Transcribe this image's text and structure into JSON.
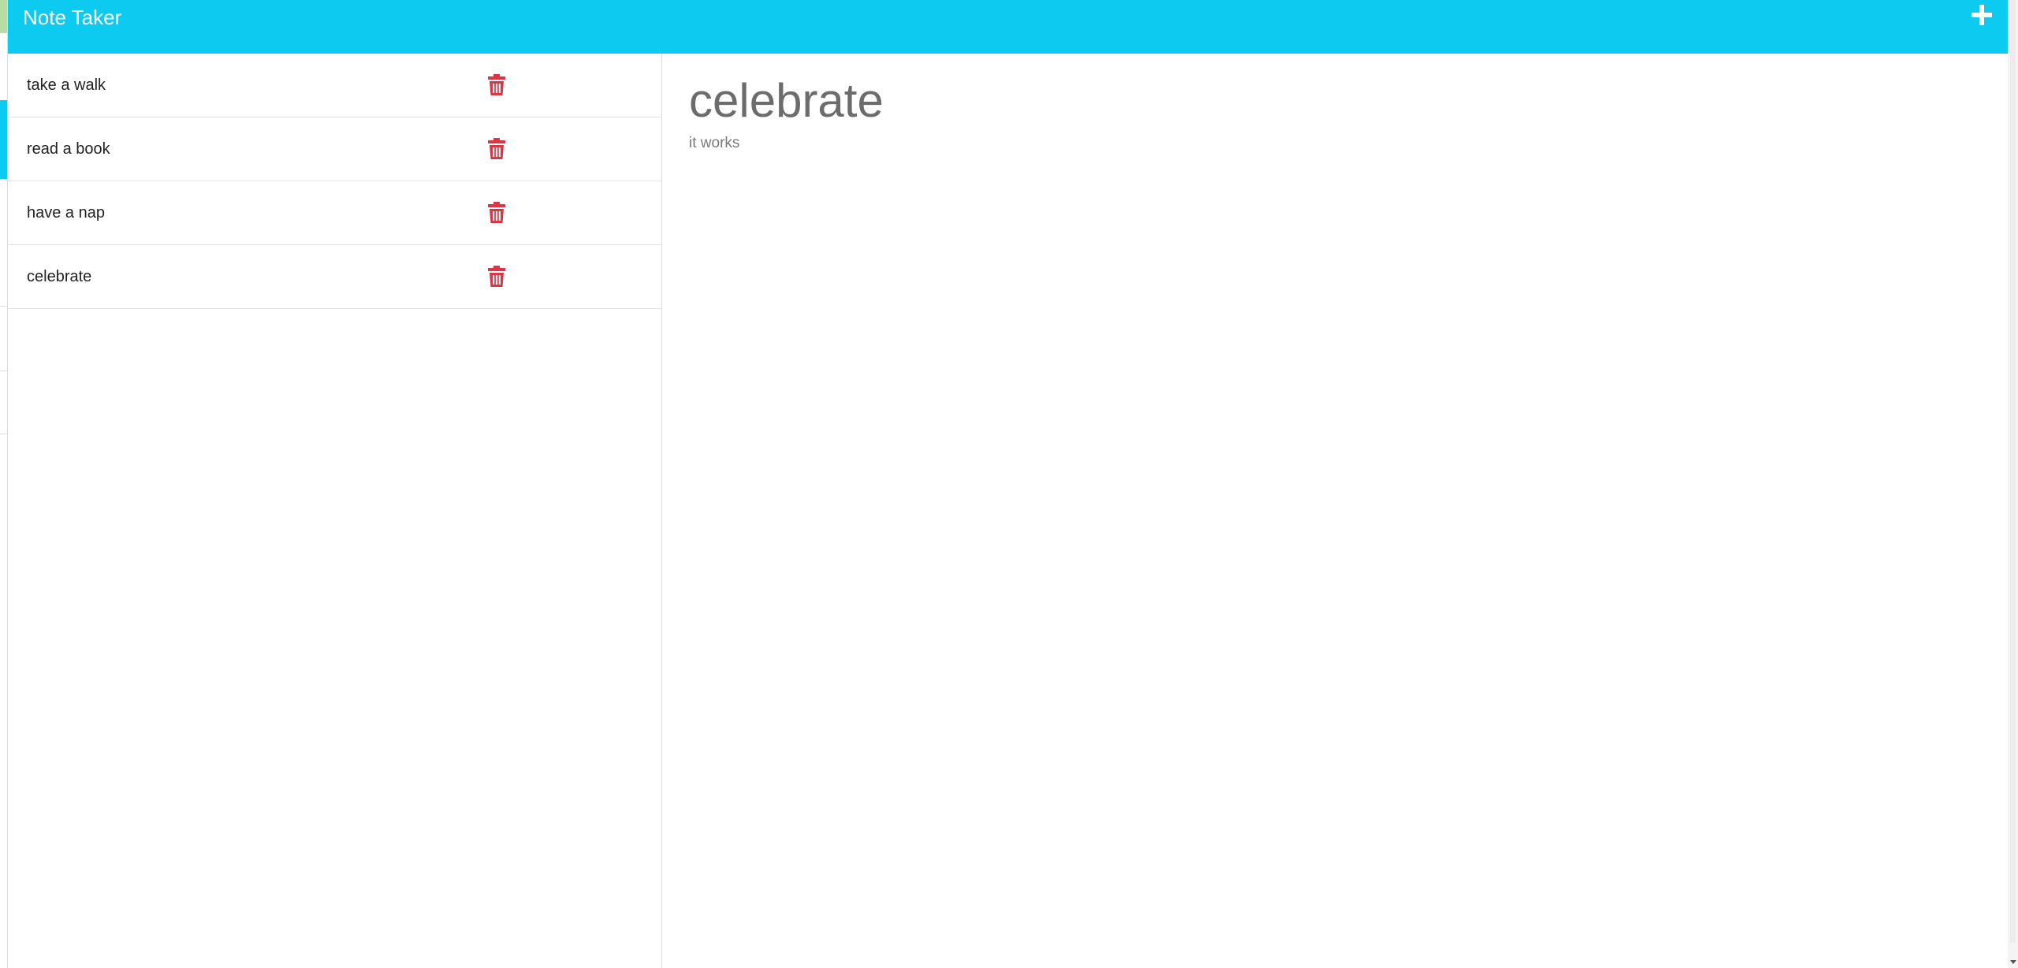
{
  "app": {
    "title": "Note Taker"
  },
  "toolbar": {
    "add_icon": "plus-icon"
  },
  "sidebar": {
    "items": [
      {
        "label": "take a walk",
        "icon": "trash-icon"
      },
      {
        "label": "read a book",
        "icon": "trash-icon"
      },
      {
        "label": "have a nap",
        "icon": "trash-icon"
      },
      {
        "label": "celebrate",
        "icon": "trash-icon"
      }
    ]
  },
  "detail": {
    "title": "celebrate",
    "text": "it works"
  },
  "colors": {
    "accent": "#0dcaf0",
    "danger": "#dc3545",
    "title_text": "#6c6c6c"
  }
}
